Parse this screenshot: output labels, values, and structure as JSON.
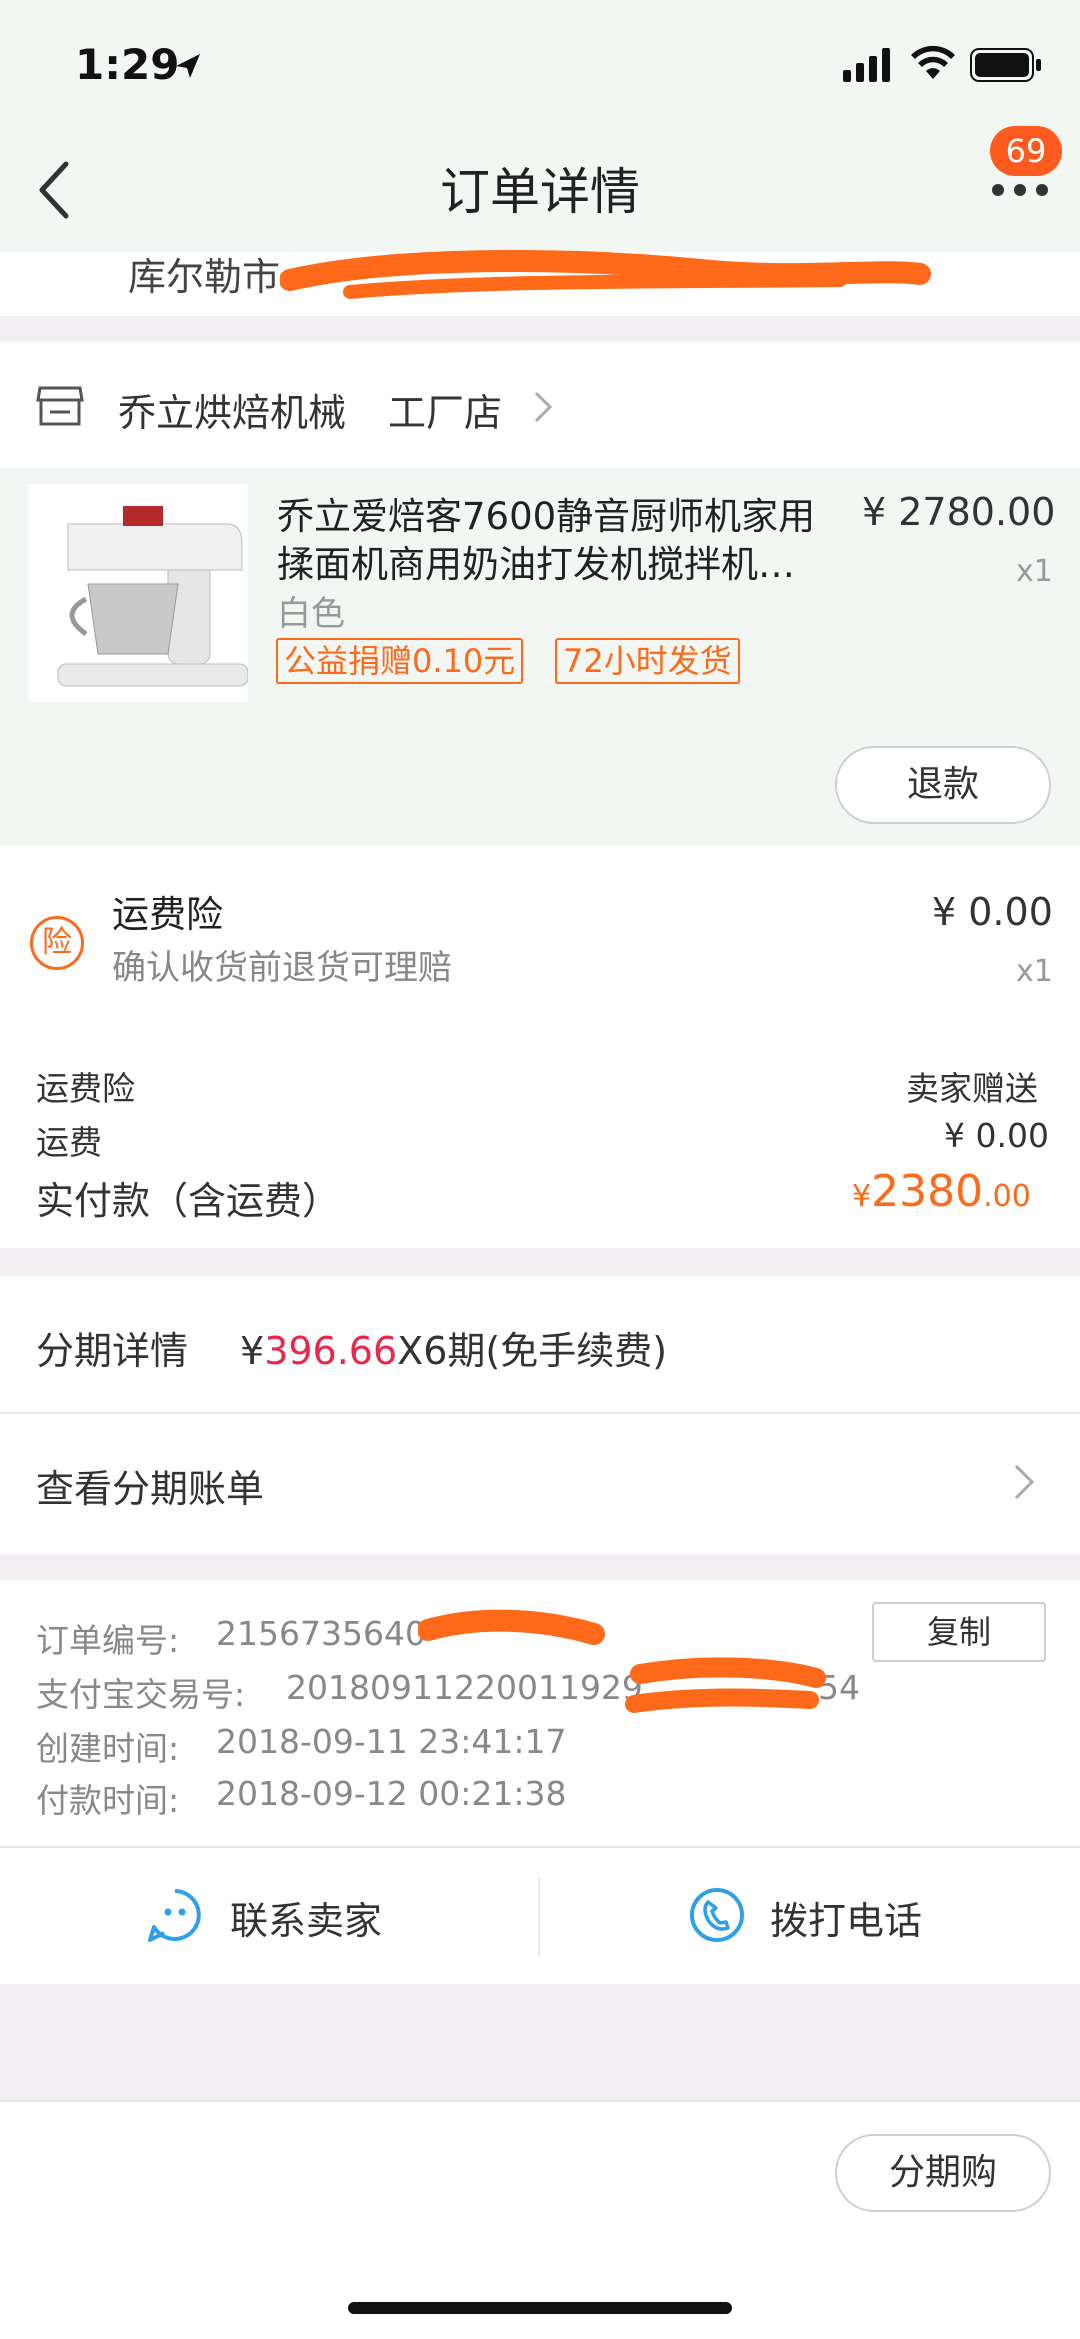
{
  "status_bar": {
    "time": "1:29"
  },
  "header": {
    "title": "订单详情",
    "badge_count": "69"
  },
  "address": {
    "partial": "库尔勒市"
  },
  "shop": {
    "name": "乔立烘焙机械",
    "type": "工厂店"
  },
  "product": {
    "title_line1": "乔立爱焙客7600静音厨师机家用",
    "title_line2": "揉面机商用奶油打发机搅拌机…",
    "variant": "白色",
    "tags": [
      "公益捐赠0.10元",
      "72小时发货"
    ],
    "price": "¥ 2780.00",
    "qty": "x1",
    "refund_label": "退款"
  },
  "insurance": {
    "icon_text": "险",
    "name": "运费险",
    "desc": "确认收货前退货可理赔",
    "price": "¥ 0.00",
    "qty": "x1"
  },
  "summary": {
    "rows": [
      {
        "label": "运费险",
        "value": "卖家赠送"
      },
      {
        "label": "运费",
        "value": "¥ 0.00"
      }
    ],
    "paid_label": "实付款（含运费）",
    "paid_currency": "¥",
    "paid_int": "2380",
    "paid_dec": ".00"
  },
  "installment": {
    "label": "分期详情",
    "currency": "¥",
    "amount": "396.66",
    "suffix": "X6期(免手续费)",
    "bill_label": "查看分期账单"
  },
  "order_info": {
    "order_no_label": "订单编号:",
    "order_no": "2156735640",
    "alipay_label": "支付宝交易号:",
    "alipay_no_head": "20180911220011929",
    "alipay_no_tail": "54",
    "created_label": "创建时间:",
    "created": "2018-09-11 23:41:17",
    "paid_label": "付款时间:",
    "paid": "2018-09-12 00:21:38",
    "copy_label": "复制"
  },
  "contact": {
    "seller": "联系卖家",
    "phone": "拨打电话"
  },
  "footer": {
    "installment_buy": "分期购"
  },
  "colors": {
    "accent": "#ff6a1a",
    "installment_red": "#e8274b",
    "icon_blue": "#2ea0e6"
  }
}
